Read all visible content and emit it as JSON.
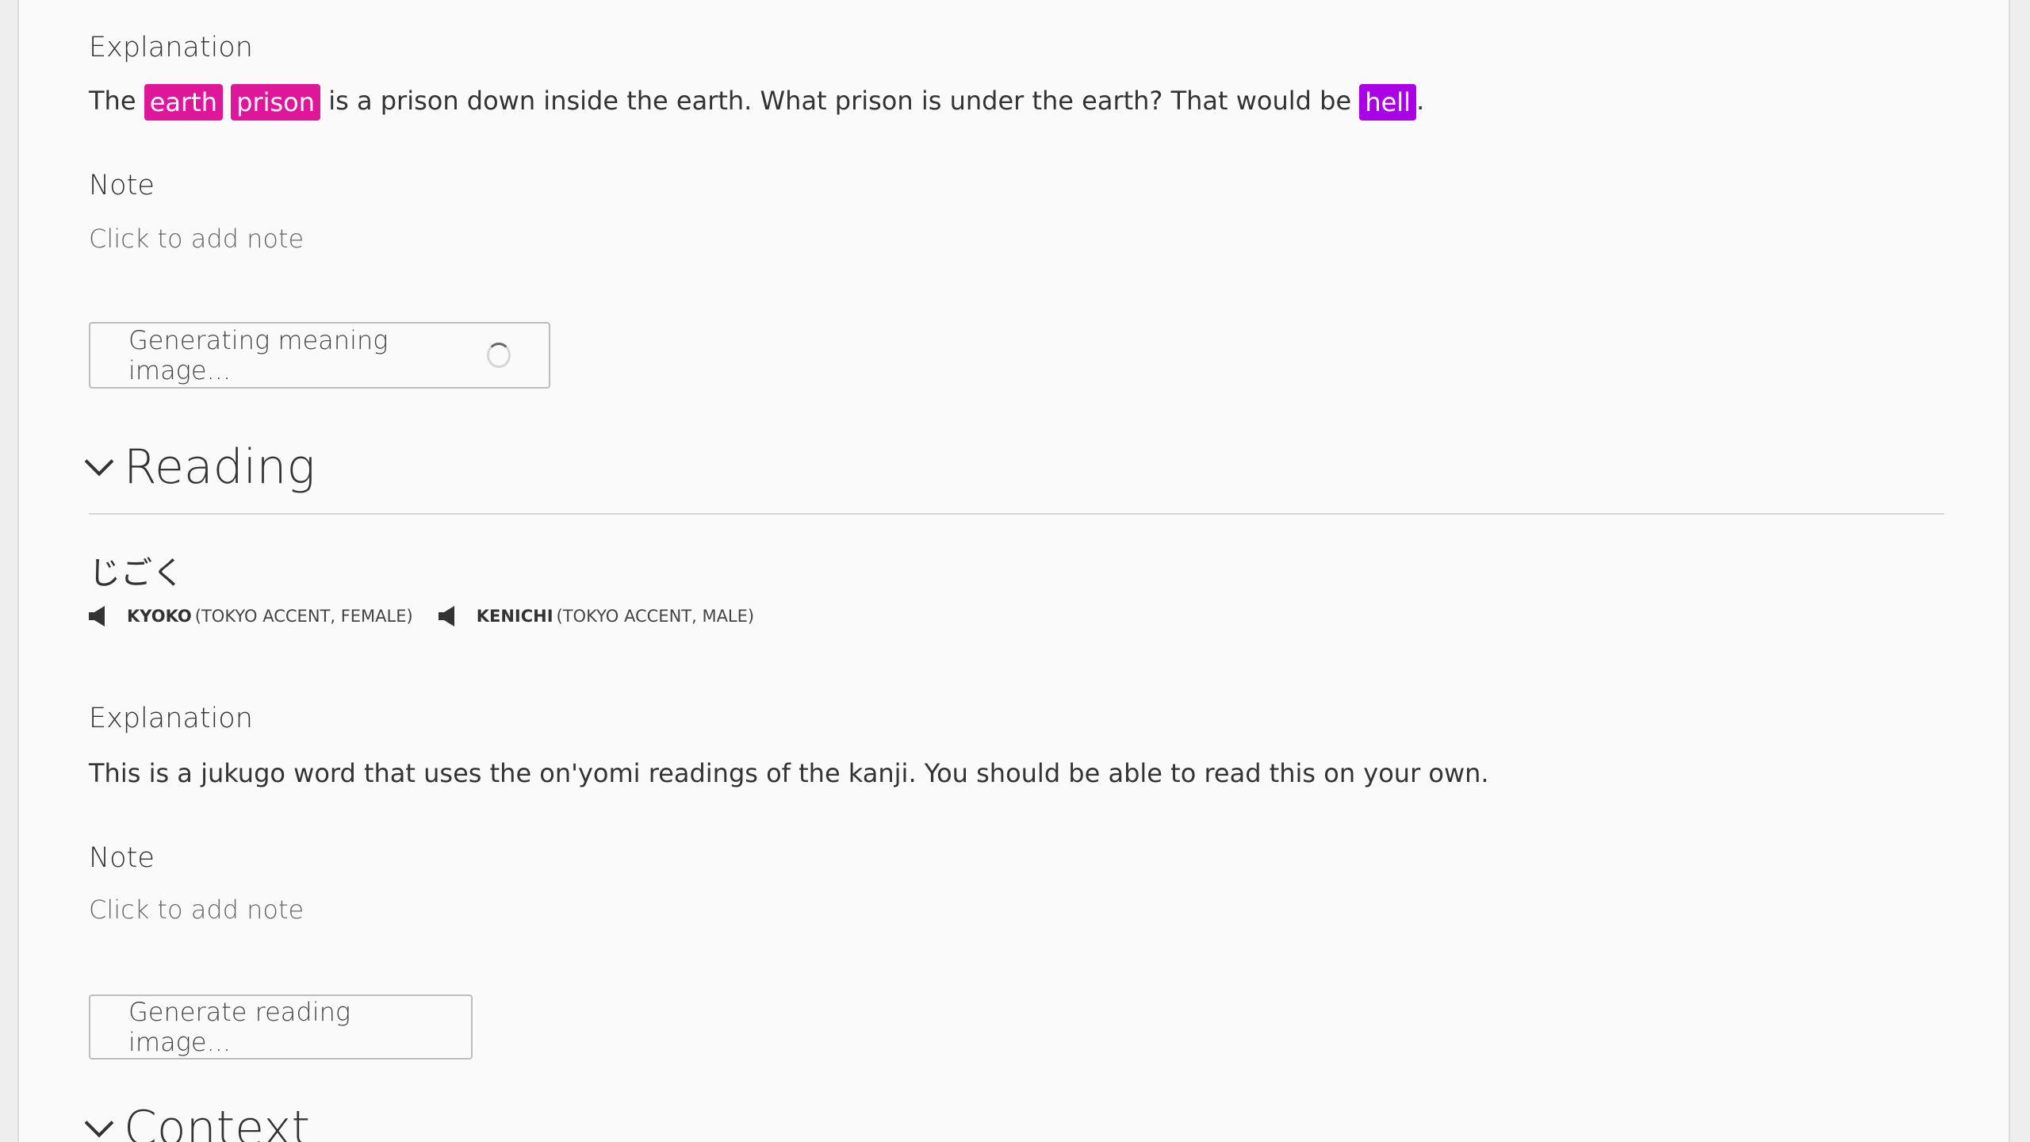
{
  "meaning": {
    "explanation_heading": "Explanation",
    "explanation": {
      "part1": "The ",
      "radical1": "earth",
      "radical2": "prison",
      "part2": " is a prison down inside the earth. What prison is under the earth? That would be ",
      "vocab": "hell",
      "part3": "."
    },
    "note_heading": "Note",
    "note_placeholder": "Click to add note",
    "image_button_label": "Generating meaning image..."
  },
  "reading_section": {
    "title": "Reading",
    "reading": "じごく",
    "voices": [
      {
        "name": "KYOKO",
        "desc": "(TOKYO ACCENT, FEMALE)"
      },
      {
        "name": "KENICHI",
        "desc": "(TOKYO ACCENT, MALE)"
      }
    ],
    "explanation_heading": "Explanation",
    "explanation": "This is a jukugo word that uses the on'yomi readings of the kanji. You should be able to read this on your own.",
    "note_heading": "Note",
    "note_placeholder": "Click to add note",
    "image_button_label": "Generate reading image..."
  },
  "context_section": {
    "title": "Context"
  },
  "colors": {
    "radical": "#e0169a",
    "vocabulary": "#aa00e8"
  }
}
